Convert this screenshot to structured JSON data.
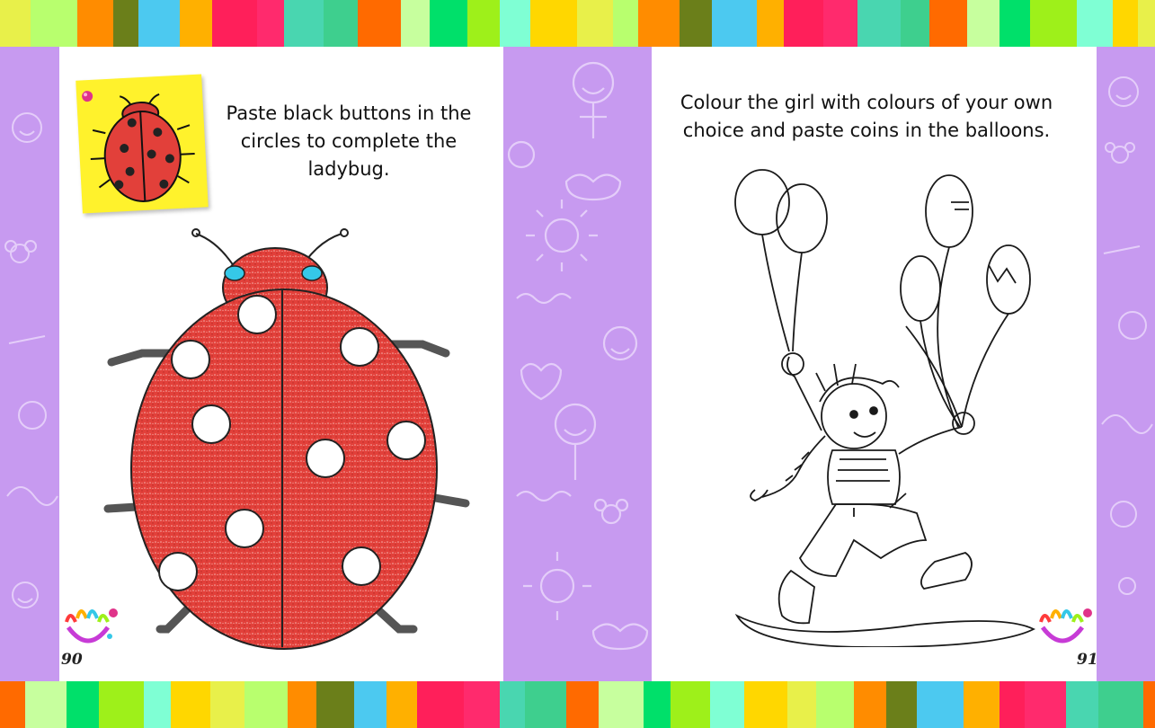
{
  "left_page": {
    "instruction": "Paste black buttons in the circles to complete the ladybug.",
    "page_number": "90",
    "sticky_note_icon": "small-ladybug-icon",
    "illustration_icon": "ladybug-outline-icon"
  },
  "right_page": {
    "instruction": "Colour the girl with colours of your own choice and paste coins in the balloons.",
    "page_number": "91",
    "illustration_icon": "girl-with-balloons-icon"
  },
  "decor": {
    "handprint_icon": "rainbow-handprint-icon",
    "background_pattern_icon": "doodle-pattern-icon",
    "colors": {
      "lilac": "#c79af0",
      "ladybug_red": "#e2403a",
      "sticky_note": "#fff22c",
      "eye_cyan": "#35c8e8"
    },
    "stripe_colors": [
      "#e8f04a",
      "#ff2a6d",
      "#7fffd4",
      "#ffb000",
      "#00e06a",
      "#6b7f1a",
      "#ff6a00",
      "#b8ff6e",
      "#49d6b0",
      "#ffd700",
      "#ff1f5a",
      "#9ef01a",
      "#4cc9f0",
      "#c7ff9e",
      "#ff8c00",
      "#3ecf8e"
    ]
  }
}
